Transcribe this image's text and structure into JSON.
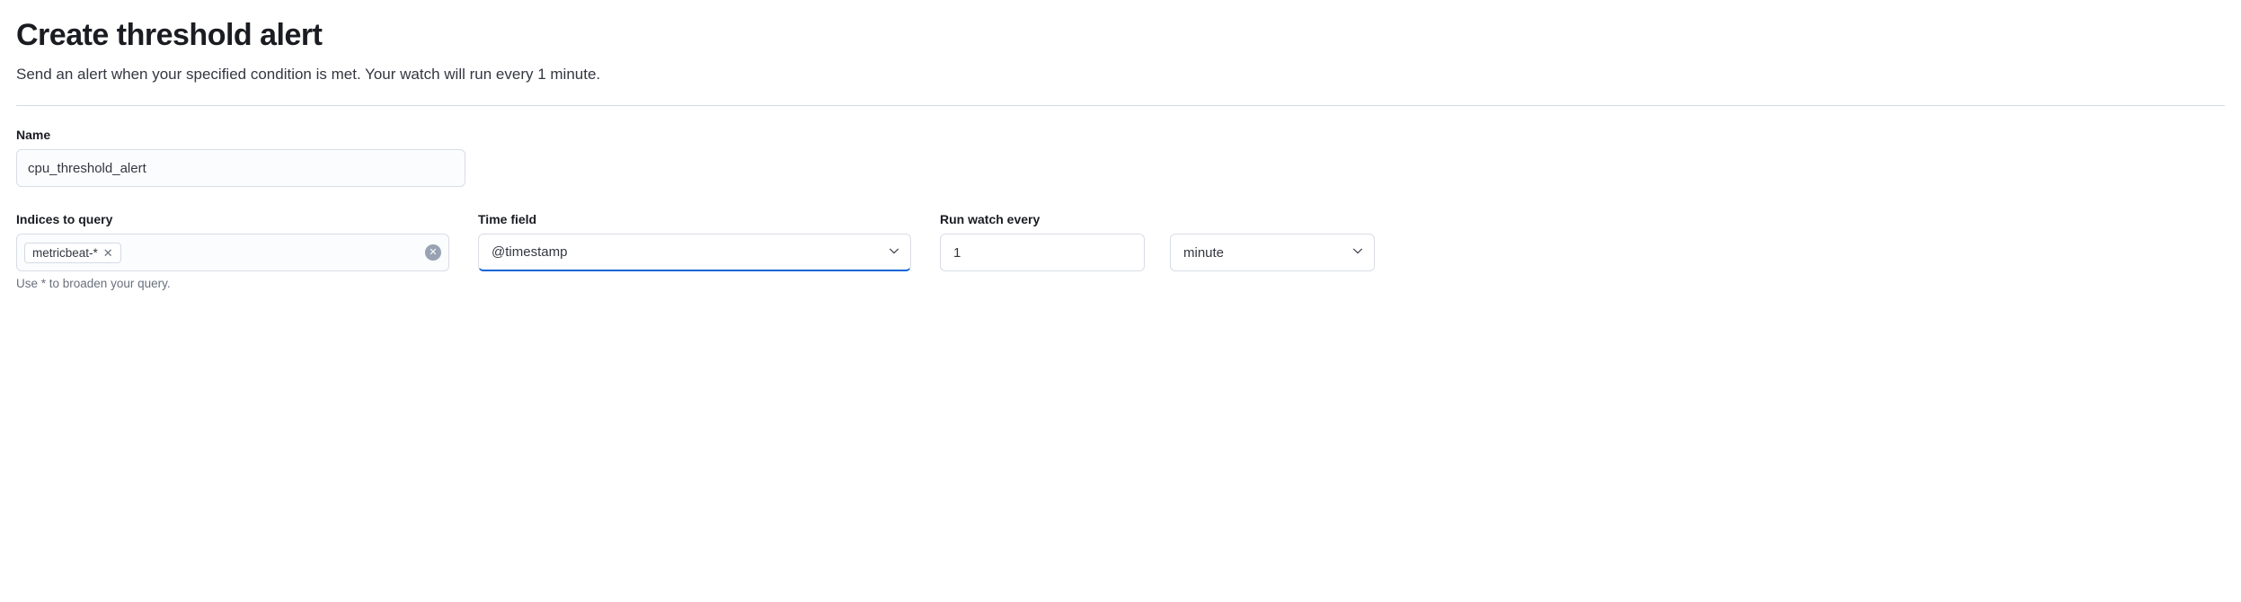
{
  "header": {
    "title": "Create threshold alert",
    "description": "Send an alert when your specified condition is met. Your watch will run every 1 minute."
  },
  "form": {
    "name": {
      "label": "Name",
      "value": "cpu_threshold_alert"
    },
    "indices": {
      "label": "Indices to query",
      "pills": [
        {
          "text": "metricbeat-*"
        }
      ],
      "help": "Use * to broaden your query."
    },
    "timefield": {
      "label": "Time field",
      "value": "@timestamp"
    },
    "runwatch": {
      "label": "Run watch every",
      "interval": "1",
      "unit": "minute"
    }
  }
}
